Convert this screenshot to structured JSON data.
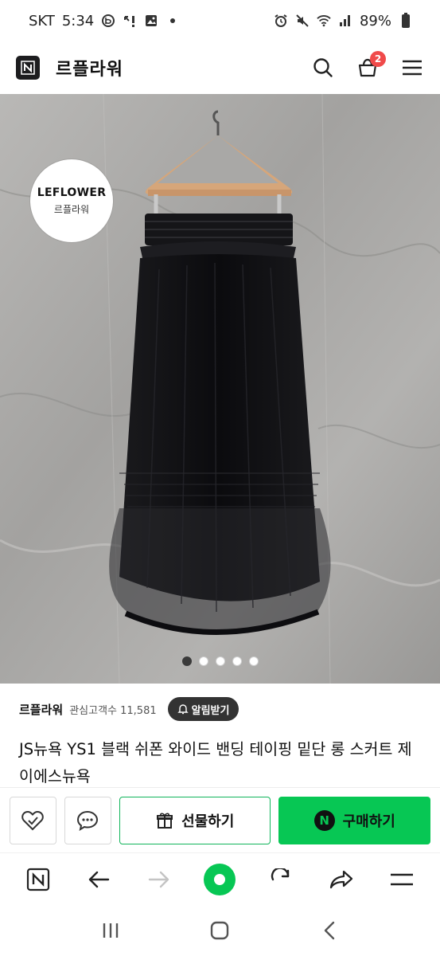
{
  "status_bar": {
    "carrier": "SKT",
    "time": "5:34",
    "battery": "89%"
  },
  "header": {
    "logo_letter": "N",
    "store_name": "르플라워",
    "cart_count": "2",
    "icons": [
      "search-icon",
      "shopping-bag-icon",
      "menu-icon"
    ]
  },
  "product_image": {
    "stamp_en": "LEFLOWER",
    "stamp_ko": "르플라워",
    "hanger_print": "LEFLOWER",
    "slide_count": 5,
    "active_slide": 1
  },
  "store_info": {
    "name": "르플라워",
    "fans": "관심고객수 11,581",
    "notify_label": "알림받기"
  },
  "product": {
    "title": "JS뉴욕 YS1 블랙 쉬폰 와이드 밴딩 테이핑 밑단 롱 스커트 제이에스뉴욕"
  },
  "actions": {
    "gift_label": "선물하기",
    "buy_label": "구매하기",
    "buy_badge": "N"
  },
  "browser_nav": {
    "home_letter": "N",
    "icons": [
      "naver-home-icon",
      "back-arrow-icon",
      "forward-arrow-icon",
      "green-dot-icon",
      "refresh-icon",
      "share-icon",
      "hamburger-menu-icon"
    ]
  },
  "colors": {
    "naver_green": "#07c754",
    "badge_red": "#f04a4a",
    "dark": "#1d1d1f"
  }
}
